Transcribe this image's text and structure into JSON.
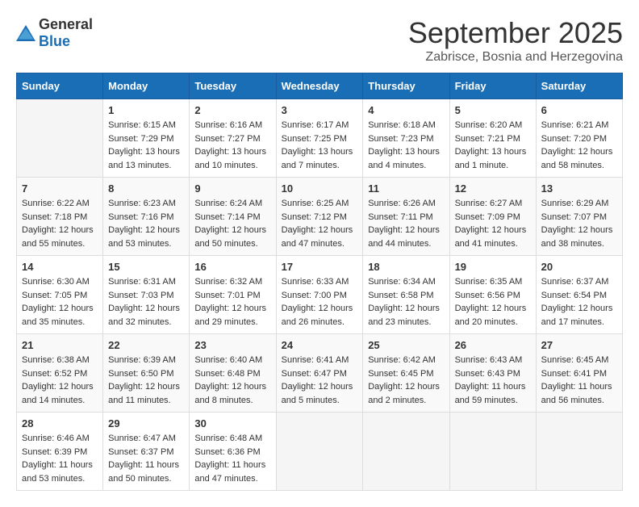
{
  "header": {
    "logo_general": "General",
    "logo_blue": "Blue",
    "month_title": "September 2025",
    "location": "Zabrisce, Bosnia and Herzegovina"
  },
  "weekdays": [
    "Sunday",
    "Monday",
    "Tuesday",
    "Wednesday",
    "Thursday",
    "Friday",
    "Saturday"
  ],
  "weeks": [
    [
      {
        "day": "",
        "sunrise": "",
        "sunset": "",
        "daylight": ""
      },
      {
        "day": "1",
        "sunrise": "Sunrise: 6:15 AM",
        "sunset": "Sunset: 7:29 PM",
        "daylight": "Daylight: 13 hours and 13 minutes."
      },
      {
        "day": "2",
        "sunrise": "Sunrise: 6:16 AM",
        "sunset": "Sunset: 7:27 PM",
        "daylight": "Daylight: 13 hours and 10 minutes."
      },
      {
        "day": "3",
        "sunrise": "Sunrise: 6:17 AM",
        "sunset": "Sunset: 7:25 PM",
        "daylight": "Daylight: 13 hours and 7 minutes."
      },
      {
        "day": "4",
        "sunrise": "Sunrise: 6:18 AM",
        "sunset": "Sunset: 7:23 PM",
        "daylight": "Daylight: 13 hours and 4 minutes."
      },
      {
        "day": "5",
        "sunrise": "Sunrise: 6:20 AM",
        "sunset": "Sunset: 7:21 PM",
        "daylight": "Daylight: 13 hours and 1 minute."
      },
      {
        "day": "6",
        "sunrise": "Sunrise: 6:21 AM",
        "sunset": "Sunset: 7:20 PM",
        "daylight": "Daylight: 12 hours and 58 minutes."
      }
    ],
    [
      {
        "day": "7",
        "sunrise": "Sunrise: 6:22 AM",
        "sunset": "Sunset: 7:18 PM",
        "daylight": "Daylight: 12 hours and 55 minutes."
      },
      {
        "day": "8",
        "sunrise": "Sunrise: 6:23 AM",
        "sunset": "Sunset: 7:16 PM",
        "daylight": "Daylight: 12 hours and 53 minutes."
      },
      {
        "day": "9",
        "sunrise": "Sunrise: 6:24 AM",
        "sunset": "Sunset: 7:14 PM",
        "daylight": "Daylight: 12 hours and 50 minutes."
      },
      {
        "day": "10",
        "sunrise": "Sunrise: 6:25 AM",
        "sunset": "Sunset: 7:12 PM",
        "daylight": "Daylight: 12 hours and 47 minutes."
      },
      {
        "day": "11",
        "sunrise": "Sunrise: 6:26 AM",
        "sunset": "Sunset: 7:11 PM",
        "daylight": "Daylight: 12 hours and 44 minutes."
      },
      {
        "day": "12",
        "sunrise": "Sunrise: 6:27 AM",
        "sunset": "Sunset: 7:09 PM",
        "daylight": "Daylight: 12 hours and 41 minutes."
      },
      {
        "day": "13",
        "sunrise": "Sunrise: 6:29 AM",
        "sunset": "Sunset: 7:07 PM",
        "daylight": "Daylight: 12 hours and 38 minutes."
      }
    ],
    [
      {
        "day": "14",
        "sunrise": "Sunrise: 6:30 AM",
        "sunset": "Sunset: 7:05 PM",
        "daylight": "Daylight: 12 hours and 35 minutes."
      },
      {
        "day": "15",
        "sunrise": "Sunrise: 6:31 AM",
        "sunset": "Sunset: 7:03 PM",
        "daylight": "Daylight: 12 hours and 32 minutes."
      },
      {
        "day": "16",
        "sunrise": "Sunrise: 6:32 AM",
        "sunset": "Sunset: 7:01 PM",
        "daylight": "Daylight: 12 hours and 29 minutes."
      },
      {
        "day": "17",
        "sunrise": "Sunrise: 6:33 AM",
        "sunset": "Sunset: 7:00 PM",
        "daylight": "Daylight: 12 hours and 26 minutes."
      },
      {
        "day": "18",
        "sunrise": "Sunrise: 6:34 AM",
        "sunset": "Sunset: 6:58 PM",
        "daylight": "Daylight: 12 hours and 23 minutes."
      },
      {
        "day": "19",
        "sunrise": "Sunrise: 6:35 AM",
        "sunset": "Sunset: 6:56 PM",
        "daylight": "Daylight: 12 hours and 20 minutes."
      },
      {
        "day": "20",
        "sunrise": "Sunrise: 6:37 AM",
        "sunset": "Sunset: 6:54 PM",
        "daylight": "Daylight: 12 hours and 17 minutes."
      }
    ],
    [
      {
        "day": "21",
        "sunrise": "Sunrise: 6:38 AM",
        "sunset": "Sunset: 6:52 PM",
        "daylight": "Daylight: 12 hours and 14 minutes."
      },
      {
        "day": "22",
        "sunrise": "Sunrise: 6:39 AM",
        "sunset": "Sunset: 6:50 PM",
        "daylight": "Daylight: 12 hours and 11 minutes."
      },
      {
        "day": "23",
        "sunrise": "Sunrise: 6:40 AM",
        "sunset": "Sunset: 6:48 PM",
        "daylight": "Daylight: 12 hours and 8 minutes."
      },
      {
        "day": "24",
        "sunrise": "Sunrise: 6:41 AM",
        "sunset": "Sunset: 6:47 PM",
        "daylight": "Daylight: 12 hours and 5 minutes."
      },
      {
        "day": "25",
        "sunrise": "Sunrise: 6:42 AM",
        "sunset": "Sunset: 6:45 PM",
        "daylight": "Daylight: 12 hours and 2 minutes."
      },
      {
        "day": "26",
        "sunrise": "Sunrise: 6:43 AM",
        "sunset": "Sunset: 6:43 PM",
        "daylight": "Daylight: 11 hours and 59 minutes."
      },
      {
        "day": "27",
        "sunrise": "Sunrise: 6:45 AM",
        "sunset": "Sunset: 6:41 PM",
        "daylight": "Daylight: 11 hours and 56 minutes."
      }
    ],
    [
      {
        "day": "28",
        "sunrise": "Sunrise: 6:46 AM",
        "sunset": "Sunset: 6:39 PM",
        "daylight": "Daylight: 11 hours and 53 minutes."
      },
      {
        "day": "29",
        "sunrise": "Sunrise: 6:47 AM",
        "sunset": "Sunset: 6:37 PM",
        "daylight": "Daylight: 11 hours and 50 minutes."
      },
      {
        "day": "30",
        "sunrise": "Sunrise: 6:48 AM",
        "sunset": "Sunset: 6:36 PM",
        "daylight": "Daylight: 11 hours and 47 minutes."
      },
      {
        "day": "",
        "sunrise": "",
        "sunset": "",
        "daylight": ""
      },
      {
        "day": "",
        "sunrise": "",
        "sunset": "",
        "daylight": ""
      },
      {
        "day": "",
        "sunrise": "",
        "sunset": "",
        "daylight": ""
      },
      {
        "day": "",
        "sunrise": "",
        "sunset": "",
        "daylight": ""
      }
    ]
  ]
}
